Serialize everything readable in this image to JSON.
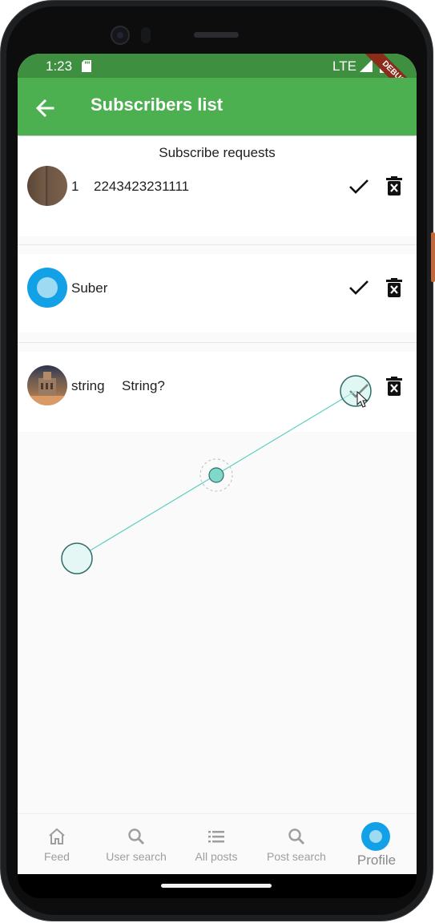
{
  "status_bar": {
    "time": "1:23",
    "network": "LTE",
    "debug_banner": "DEBUG"
  },
  "app_bar": {
    "title": "Subscribers list",
    "back_icon": "arrow-back-icon"
  },
  "section": {
    "title": "Subscribe requests"
  },
  "subscribers": [
    {
      "name": "1",
      "detail": "2243423231111",
      "avatar": "wood-avatar"
    },
    {
      "name": "Suber",
      "detail": "",
      "avatar": "blue-circle-avatar"
    },
    {
      "name": "string",
      "detail": "String?",
      "avatar": "photo-avatar"
    }
  ],
  "bottom_nav": {
    "items": [
      {
        "label": "Feed",
        "icon": "home-icon"
      },
      {
        "label": "User search",
        "icon": "search-icon"
      },
      {
        "label": "All posts",
        "icon": "list-icon"
      },
      {
        "label": "Post search",
        "icon": "search-icon"
      },
      {
        "label": "Profile",
        "icon": "profile-avatar-icon"
      }
    ],
    "active": "Profile"
  },
  "colors": {
    "app_bar": "#4caf50",
    "status_bar": "#3f8f41",
    "profile_accent": "#12a0e6",
    "gesture_trace": "#5fcfc0"
  }
}
